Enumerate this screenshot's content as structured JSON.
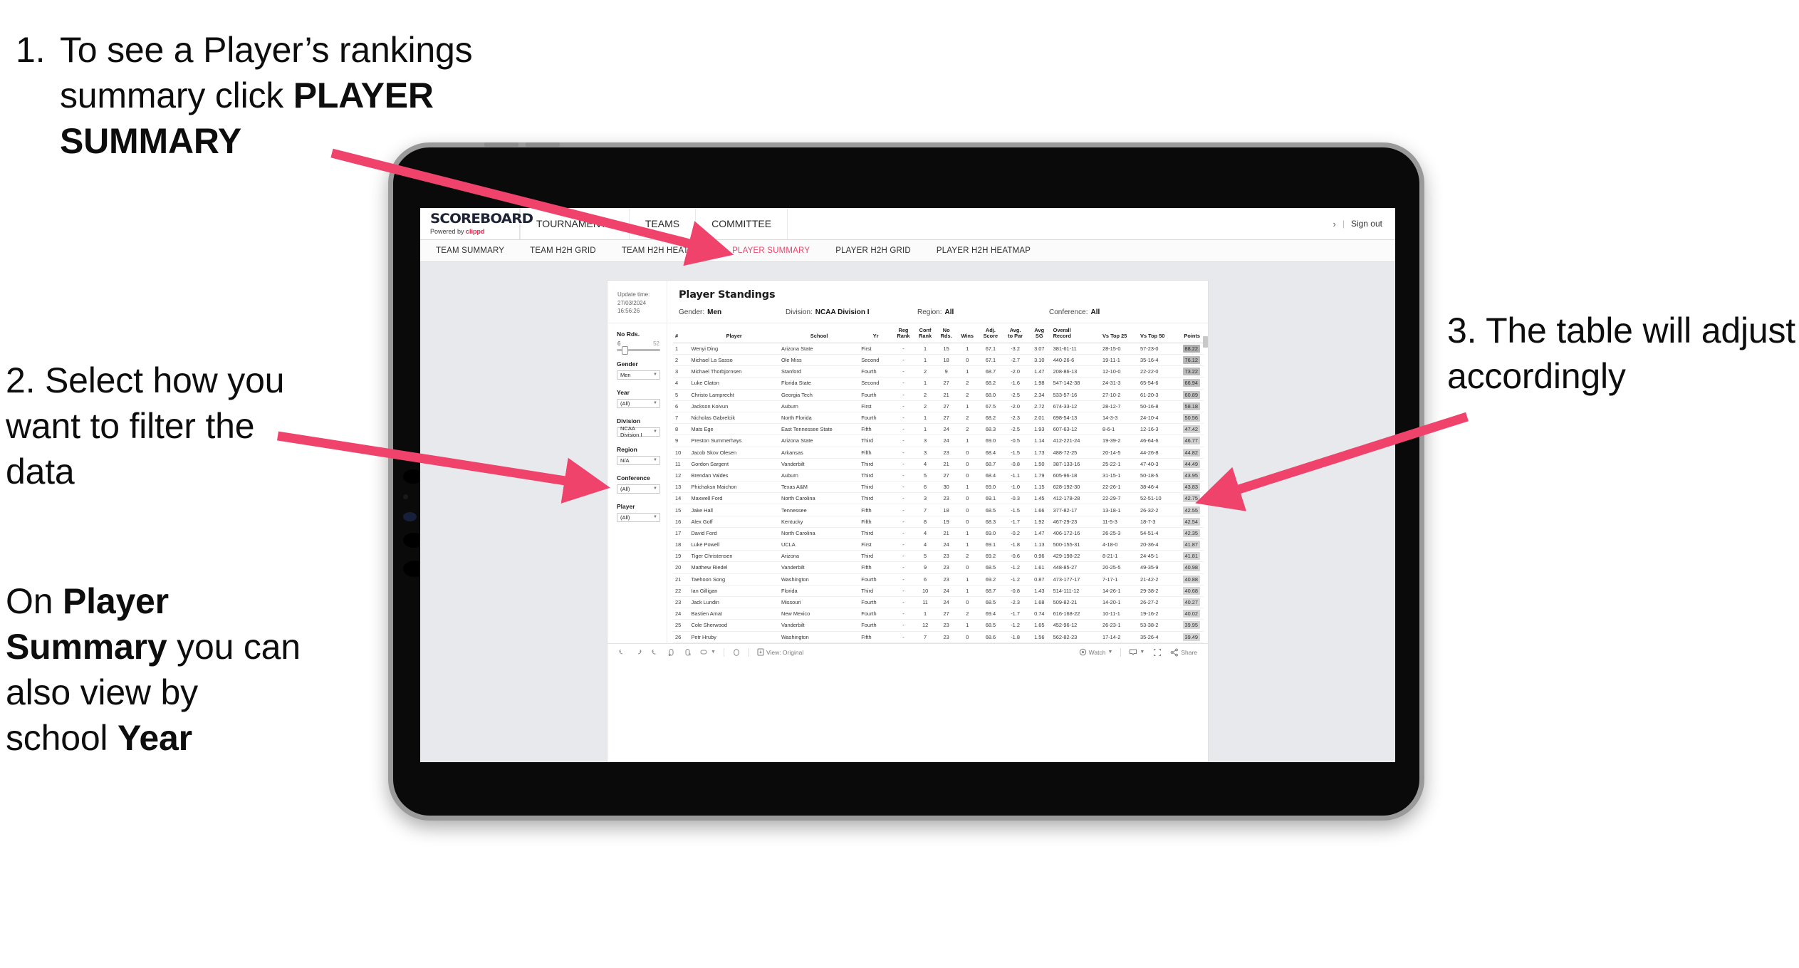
{
  "slide": {
    "annotations": [
      {
        "number": "1.",
        "text_before": "To see a Player’s rankings summary click ",
        "bold": "PLAYER SUMMARY"
      },
      {
        "number": "2.",
        "text": "2. Select how you want to filter the data"
      },
      {
        "number": "3.",
        "text": "3. The table will adjust accordingly"
      }
    ],
    "annot2_extra": {
      "p1": "On ",
      "b1": "Player Summary",
      "p2": " you can also view by school ",
      "b2": "Year"
    },
    "accent_color": "#f0436c"
  },
  "app": {
    "logo": {
      "main": "SCOREBOARD",
      "sub_prefix": "Powered by ",
      "sub_brand": "clippd"
    },
    "topnav": [
      "TOURNAMENTS",
      "TEAMS",
      "COMMITTEE"
    ],
    "account": {
      "chevron": "›",
      "separator": "|",
      "sign_out": "Sign out"
    },
    "subnav": [
      {
        "label": "TEAM SUMMARY",
        "active": false
      },
      {
        "label": "TEAM H2H GRID",
        "active": false
      },
      {
        "label": "TEAM H2H HEATMAP",
        "active": false
      },
      {
        "label": "PLAYER SUMMARY",
        "active": true
      },
      {
        "label": "PLAYER H2H GRID",
        "active": false
      },
      {
        "label": "PLAYER H2H HEATMAP",
        "active": false
      }
    ]
  },
  "dashboard": {
    "update_time_label": "Update time:",
    "update_time_value": "27/03/2024 16:56:26",
    "title": "Player Standings",
    "summary_filters": [
      {
        "label": "Gender:",
        "value": "Men"
      },
      {
        "label": "Division:",
        "value": "NCAA Division I"
      },
      {
        "label": "Region:",
        "value": "All"
      },
      {
        "label": "Conference:",
        "value": "All"
      }
    ],
    "filters": {
      "slider": {
        "label": "No Rds.",
        "min": "6",
        "max": "52"
      },
      "selects": [
        {
          "label": "Gender",
          "value": "Men"
        },
        {
          "label": "Year",
          "value": "(All)"
        },
        {
          "label": "Division",
          "value": "NCAA Division I"
        },
        {
          "label": "Region",
          "value": "N/A"
        },
        {
          "label": "Conference",
          "value": "(All)"
        },
        {
          "label": "Player",
          "value": "(All)"
        }
      ]
    },
    "toolbar": {
      "view_label": "View: Original",
      "watch_label": "Watch",
      "share_label": "Share"
    }
  },
  "table": {
    "headers": [
      "#",
      "Player",
      "School",
      "Yr",
      "Reg Rank",
      "Conf Rank",
      "No Rds.",
      "Wins",
      "Adj. Score",
      "Avg. to Par",
      "Avg SG",
      "Overall Record",
      "Vs Top 25",
      "Vs Top 50",
      "Points"
    ],
    "headers_split": [
      {
        "l1": "#",
        "l2": ""
      },
      {
        "l1": "Player",
        "l2": ""
      },
      {
        "l1": "School",
        "l2": ""
      },
      {
        "l1": "Yr",
        "l2": ""
      },
      {
        "l1": "Reg",
        "l2": "Rank"
      },
      {
        "l1": "Conf",
        "l2": "Rank"
      },
      {
        "l1": "No",
        "l2": "Rds."
      },
      {
        "l1": "Wins",
        "l2": ""
      },
      {
        "l1": "Adj.",
        "l2": "Score"
      },
      {
        "l1": "Avg.",
        "l2": "to Par"
      },
      {
        "l1": "Avg",
        "l2": "SG"
      },
      {
        "l1": "Overall",
        "l2": "Record"
      },
      {
        "l1": "Vs Top 25",
        "l2": ""
      },
      {
        "l1": "Vs Top 50",
        "l2": ""
      },
      {
        "l1": "Points",
        "l2": ""
      }
    ],
    "rows": [
      [
        "1",
        "Wenyi Ding",
        "Arizona State",
        "First",
        "-",
        "1",
        "15",
        "1",
        "67.1",
        "-3.2",
        "3.07",
        "381-61-11",
        "28-15-0",
        "57-23-0",
        "88.22"
      ],
      [
        "2",
        "Michael La Sasso",
        "Ole Miss",
        "Second",
        "-",
        "1",
        "18",
        "0",
        "67.1",
        "-2.7",
        "3.10",
        "440-26-6",
        "19-11-1",
        "35-16-4",
        "76.12"
      ],
      [
        "3",
        "Michael Thorbjornsen",
        "Stanford",
        "Fourth",
        "-",
        "2",
        "9",
        "1",
        "68.7",
        "-2.0",
        "1.47",
        "208-86-13",
        "12-10-0",
        "22-22-0",
        "73.22"
      ],
      [
        "4",
        "Luke Claton",
        "Florida State",
        "Second",
        "-",
        "1",
        "27",
        "2",
        "68.2",
        "-1.6",
        "1.98",
        "547-142-38",
        "24-31-3",
        "65-54-6",
        "66.94"
      ],
      [
        "5",
        "Christo Lamprecht",
        "Georgia Tech",
        "Fourth",
        "-",
        "2",
        "21",
        "2",
        "68.0",
        "-2.5",
        "2.34",
        "533-57-16",
        "27-10-2",
        "61-20-3",
        "60.89"
      ],
      [
        "6",
        "Jackson Koivun",
        "Auburn",
        "First",
        "-",
        "2",
        "27",
        "1",
        "67.5",
        "-2.0",
        "2.72",
        "674-33-12",
        "28-12-7",
        "50-16-8",
        "58.18"
      ],
      [
        "7",
        "Nicholas Gabrelcik",
        "North Florida",
        "Fourth",
        "-",
        "1",
        "27",
        "2",
        "68.2",
        "-2.3",
        "2.01",
        "698-54-13",
        "14-3-3",
        "24-10-4",
        "50.56"
      ],
      [
        "8",
        "Mats Ege",
        "East Tennessee State",
        "Fifth",
        "-",
        "1",
        "24",
        "2",
        "68.3",
        "-2.5",
        "1.93",
        "607-63-12",
        "8-6-1",
        "12-16-3",
        "47.42"
      ],
      [
        "9",
        "Preston Summerhays",
        "Arizona State",
        "Third",
        "-",
        "3",
        "24",
        "1",
        "69.0",
        "-0.5",
        "1.14",
        "412-221-24",
        "19-39-2",
        "46-64-6",
        "46.77"
      ],
      [
        "10",
        "Jacob Skov Olesen",
        "Arkansas",
        "Fifth",
        "-",
        "3",
        "23",
        "0",
        "68.4",
        "-1.5",
        "1.73",
        "488-72-25",
        "20-14-5",
        "44-26-8",
        "44.82"
      ],
      [
        "11",
        "Gordon Sargent",
        "Vanderbilt",
        "Third",
        "-",
        "4",
        "21",
        "0",
        "68.7",
        "-0.8",
        "1.50",
        "387-133-16",
        "25-22-1",
        "47-40-3",
        "44.49"
      ],
      [
        "12",
        "Brendan Valdes",
        "Auburn",
        "Third",
        "-",
        "5",
        "27",
        "0",
        "68.4",
        "-1.1",
        "1.79",
        "605-96-18",
        "31-15-1",
        "50-18-5",
        "43.95"
      ],
      [
        "13",
        "Phichaksn Maichon",
        "Texas A&M",
        "Third",
        "-",
        "6",
        "30",
        "1",
        "69.0",
        "-1.0",
        "1.15",
        "628-192-30",
        "22-26-1",
        "38-46-4",
        "43.83"
      ],
      [
        "14",
        "Maxwell Ford",
        "North Carolina",
        "Third",
        "-",
        "3",
        "23",
        "0",
        "69.1",
        "-0.3",
        "1.45",
        "412-178-28",
        "22-29-7",
        "52-51-10",
        "42.75"
      ],
      [
        "15",
        "Jake Hall",
        "Tennessee",
        "Fifth",
        "-",
        "7",
        "18",
        "0",
        "68.5",
        "-1.5",
        "1.66",
        "377-82-17",
        "13-18-1",
        "26-32-2",
        "42.55"
      ],
      [
        "16",
        "Alex Goff",
        "Kentucky",
        "Fifth",
        "-",
        "8",
        "19",
        "0",
        "68.3",
        "-1.7",
        "1.92",
        "467-29-23",
        "11-5-3",
        "18-7-3",
        "42.54"
      ],
      [
        "17",
        "David Ford",
        "North Carolina",
        "Third",
        "-",
        "4",
        "21",
        "1",
        "69.0",
        "-0.2",
        "1.47",
        "406-172-16",
        "26-25-3",
        "54-51-4",
        "42.35"
      ],
      [
        "18",
        "Luke Powell",
        "UCLA",
        "First",
        "-",
        "4",
        "24",
        "1",
        "69.1",
        "-1.8",
        "1.13",
        "500-155-31",
        "4-18-0",
        "20-36-4",
        "41.87"
      ],
      [
        "19",
        "Tiger Christensen",
        "Arizona",
        "Third",
        "-",
        "5",
        "23",
        "2",
        "69.2",
        "-0.6",
        "0.96",
        "429-198-22",
        "8-21-1",
        "24-45-1",
        "41.81"
      ],
      [
        "20",
        "Matthew Riedel",
        "Vanderbilt",
        "Fifth",
        "-",
        "9",
        "23",
        "0",
        "68.5",
        "-1.2",
        "1.61",
        "448-85-27",
        "20-25-5",
        "49-35-9",
        "40.98"
      ],
      [
        "21",
        "Taehoon Song",
        "Washington",
        "Fourth",
        "-",
        "6",
        "23",
        "1",
        "69.2",
        "-1.2",
        "0.87",
        "473-177-17",
        "7-17-1",
        "21-42-2",
        "40.88"
      ],
      [
        "22",
        "Ian Gilligan",
        "Florida",
        "Third",
        "-",
        "10",
        "24",
        "1",
        "68.7",
        "-0.8",
        "1.43",
        "514-111-12",
        "14-26-1",
        "29-38-2",
        "40.68"
      ],
      [
        "23",
        "Jack Lundin",
        "Missouri",
        "Fourth",
        "-",
        "11",
        "24",
        "0",
        "68.5",
        "-2.3",
        "1.68",
        "509-82-21",
        "14-20-1",
        "26-27-2",
        "40.27"
      ],
      [
        "24",
        "Bastien Amat",
        "New Mexico",
        "Fourth",
        "-",
        "1",
        "27",
        "2",
        "69.4",
        "-1.7",
        "0.74",
        "616-168-22",
        "10-11-1",
        "19-16-2",
        "40.02"
      ],
      [
        "25",
        "Cole Sherwood",
        "Vanderbilt",
        "Fourth",
        "-",
        "12",
        "23",
        "1",
        "68.5",
        "-1.2",
        "1.65",
        "452-96-12",
        "26-23-1",
        "53-38-2",
        "39.95"
      ],
      [
        "26",
        "Petr Hruby",
        "Washington",
        "Fifth",
        "-",
        "7",
        "23",
        "0",
        "68.6",
        "-1.8",
        "1.56",
        "562-82-23",
        "17-14-2",
        "35-26-4",
        "39.49"
      ]
    ]
  }
}
